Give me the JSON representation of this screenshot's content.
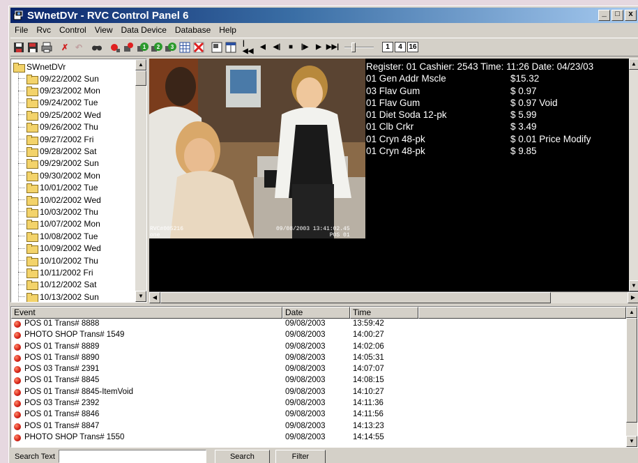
{
  "window": {
    "title": "SWnetDVr - RVC Control Panel 6",
    "minimize": "_",
    "maximize": "□",
    "close": "x"
  },
  "menu": [
    "File",
    "Rvc",
    "Control",
    "View",
    "Data Device",
    "Database",
    "Help"
  ],
  "toolbar": {
    "zoom_buttons": [
      "1",
      "4",
      "16"
    ]
  },
  "tree": {
    "root": "SWnetDVr",
    "items": [
      "09/22/2002 Sun",
      "09/23/2002 Mon",
      "09/24/2002 Tue",
      "09/25/2002 Wed",
      "09/26/2002 Thu",
      "09/27/2002 Fri",
      "09/28/2002 Sat",
      "09/29/2002 Sun",
      "09/30/2002 Mon",
      "10/01/2002 Tue",
      "10/02/2002 Wed",
      "10/03/2002 Thu",
      "10/07/2002 Mon",
      "10/08/2002 Tue",
      "10/09/2002 Wed",
      "10/10/2002 Thu",
      "10/11/2002 Fri",
      "10/12/2002 Sat",
      "10/13/2002 Sun"
    ]
  },
  "video": {
    "osd_left": "RVC#005216\none",
    "osd_right": "09/08/2003 13:41:02.45\n       POS 01"
  },
  "receipt": {
    "header": "Register: 01  Cashier: 2543  Time: 11:26  Date: 04/23/03",
    "lines": [
      {
        "item": "01 Gen Addr Mscle",
        "amount": "$15.32"
      },
      {
        "item": "03 Flav Gum",
        "amount": "$ 0.97"
      },
      {
        "item": "01 Flav Gum",
        "amount": "$ 0.97 Void"
      },
      {
        "item": "01 Diet Soda  12-pk",
        "amount": "$ 5.99"
      },
      {
        "item": "01 Clb Crkr",
        "amount": "$ 3.49"
      },
      {
        "item": "01 Cryn  48-pk",
        "amount": "$ 0.01 Price Modify"
      },
      {
        "item": "01 Cryn  48-pk",
        "amount": "$ 9.85"
      }
    ]
  },
  "events": {
    "columns": [
      "Event",
      "Date",
      "Time"
    ],
    "rows": [
      [
        "POS 01 Trans# 8888",
        "09/08/2003",
        "13:59:42"
      ],
      [
        "PHOTO SHOP Trans# 1549",
        "09/08/2003",
        "14:00:27"
      ],
      [
        "POS 01 Trans# 8889",
        "09/08/2003",
        "14:02:06"
      ],
      [
        "POS 01 Trans# 8890",
        "09/08/2003",
        "14:05:31"
      ],
      [
        "POS 03 Trans# 2391",
        "09/08/2003",
        "14:07:07"
      ],
      [
        "POS 01 Trans# 8845",
        "09/08/2003",
        "14:08:15"
      ],
      [
        "POS 01 Trans# 8845-ItemVoid",
        "09/08/2003",
        "14:10:27"
      ],
      [
        "POS 03 Trans# 2392",
        "09/08/2003",
        "14:11:36"
      ],
      [
        "POS 01 Trans# 8846",
        "09/08/2003",
        "14:11:56"
      ],
      [
        "POS 01 Trans# 8847",
        "09/08/2003",
        "14:13:23"
      ],
      [
        "PHOTO SHOP Trans# 1550",
        "09/08/2003",
        "14:14:55"
      ]
    ]
  },
  "bottom": {
    "search_label": "Search Text",
    "search_value": "",
    "search_button": "Search",
    "filter_button": "Filter"
  }
}
